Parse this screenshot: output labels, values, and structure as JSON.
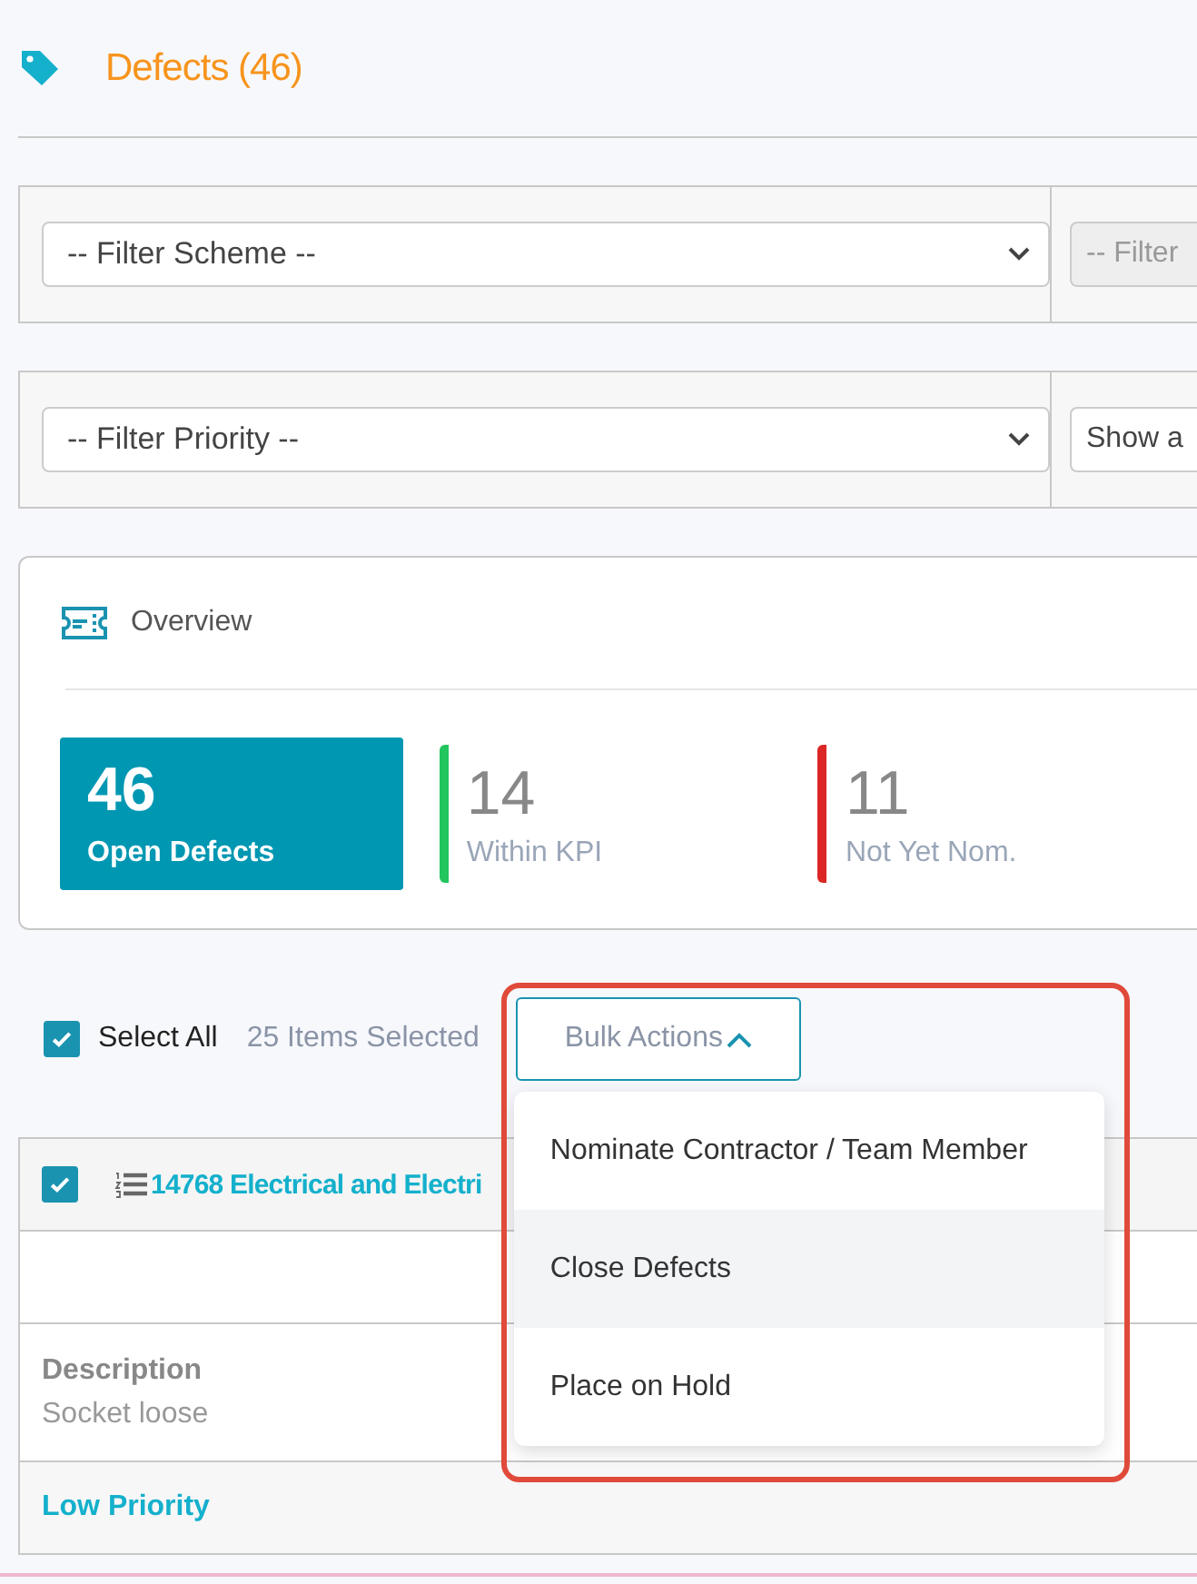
{
  "header": {
    "title": "Defects (46)"
  },
  "filters": [
    [
      {
        "placeholder": "-- Filter Scheme --",
        "disabled": false
      },
      {
        "placeholder": "-- Filter",
        "disabled": true
      }
    ],
    [
      {
        "placeholder": "-- Filter Priority --",
        "disabled": false
      },
      {
        "value": "Show a",
        "disabled": false
      }
    ]
  ],
  "overview": {
    "title": "Overview",
    "stats": [
      {
        "value": "46",
        "label": "Open Defects",
        "color": "#0097b2",
        "selected": true
      },
      {
        "value": "14",
        "label": "Within KPI",
        "color": "#22c55e",
        "selected": false
      },
      {
        "value": "11",
        "label": "Not Yet Nom.",
        "color": "#dc2626",
        "selected": false
      }
    ]
  },
  "toolbar": {
    "select_all": {
      "label": "Select All",
      "checked": true
    },
    "selected_count": "25 Items Selected",
    "bulk_actions": {
      "label": "Bulk Actions",
      "expanded": true,
      "highlighted": true,
      "items": [
        {
          "label": "Nominate Contractor / Team Member",
          "selected": false
        },
        {
          "label": "Close Defects",
          "selected": true
        },
        {
          "label": "Place on Hold",
          "selected": false
        }
      ]
    }
  },
  "defect": {
    "checked": true,
    "title": "14768 Electrical and Electri",
    "description_label": "Description",
    "description": "Socket loose",
    "priority": "Low Priority"
  }
}
